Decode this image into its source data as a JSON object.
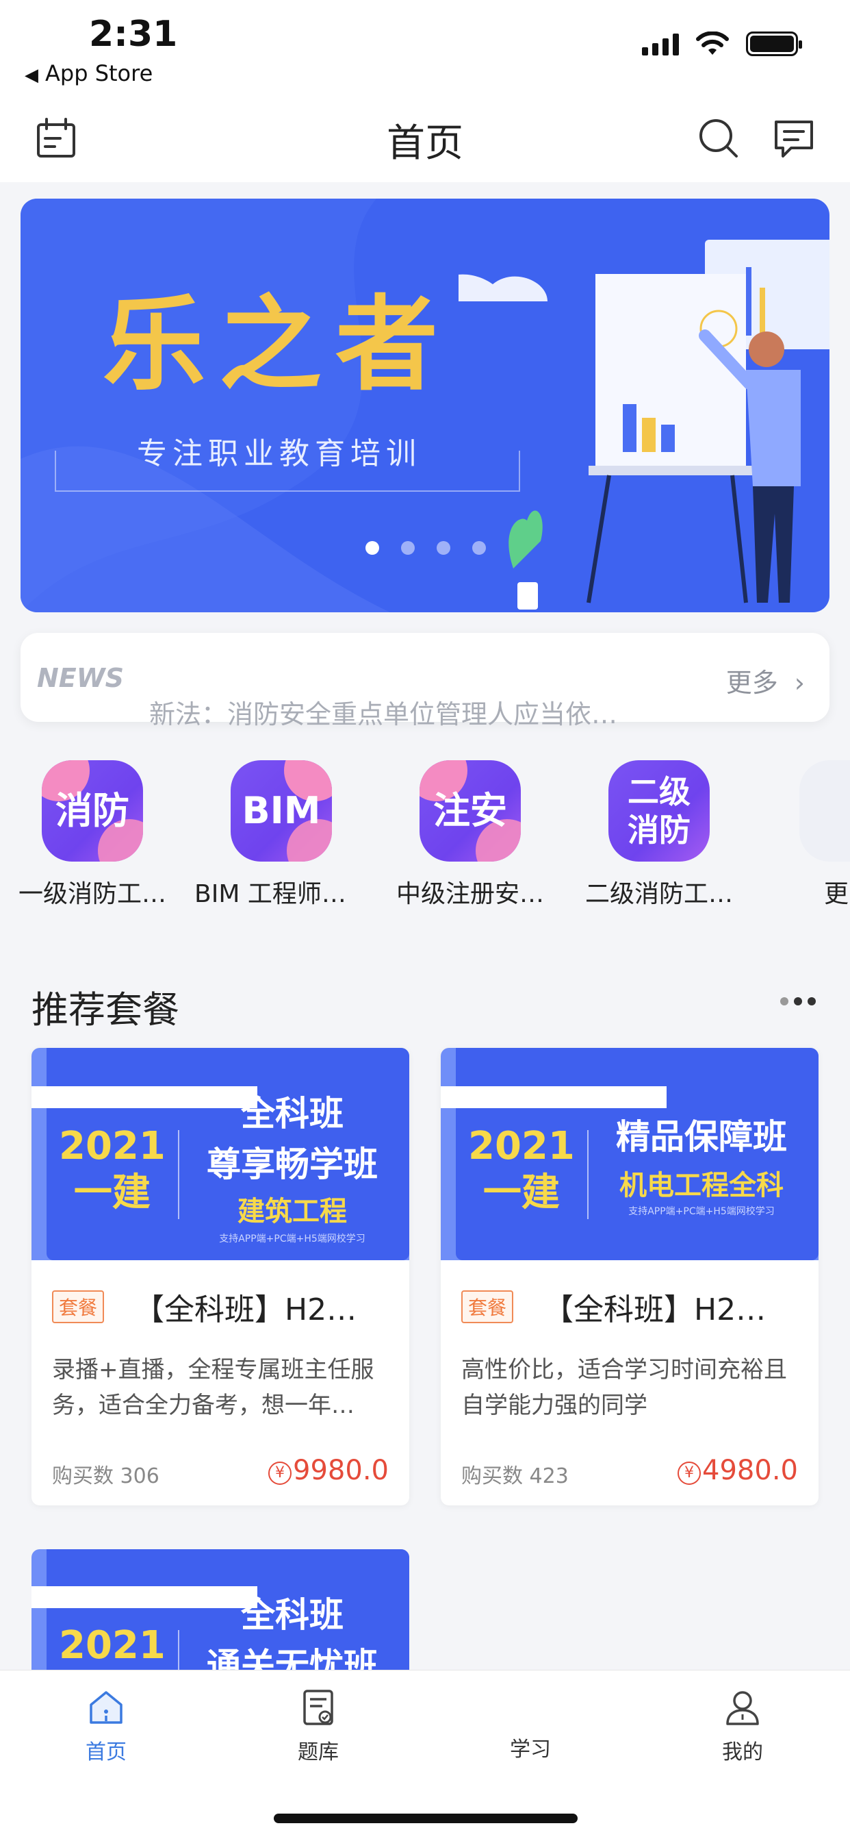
{
  "status_bar": {
    "time": "2:31",
    "back_app": "App Store"
  },
  "nav": {
    "title": "首页"
  },
  "banner": {
    "title": "乐之者",
    "subtitle": "专注职业教育培训",
    "dots": 4,
    "active_dot": 1
  },
  "news": {
    "tag": "NEWS",
    "text": "新法：消防安全重点单位管理人应当依…",
    "more": "更多"
  },
  "categories": [
    {
      "icon_text": "消防",
      "label": "一级消防工…"
    },
    {
      "icon_text": "BIM",
      "label": "BIM 工程师＋…"
    },
    {
      "icon_text": "注安",
      "label": "中级注册安…"
    },
    {
      "icon_text": "二级 消防",
      "label": "二级消防工…"
    },
    {
      "icon_text": "",
      "label": "更"
    }
  ],
  "section": {
    "title": "推荐套餐"
  },
  "cards": [
    {
      "img": {
        "year": "2021",
        "year_line2": "一建",
        "line1": "全科班",
        "line2": "尊享畅学班",
        "line3": "建筑工程",
        "note": "支持APP端+PC端+H5端网校学习"
      },
      "tag": "套餐",
      "title": "【全科班】H2…",
      "desc": "录播+直播，全程专属班主任服务，适合全力备考，想一年…",
      "buy_label": "购买数 306",
      "price": "9980.0"
    },
    {
      "img": {
        "year": "2021",
        "year_line2": "一建",
        "line1": "精品保障班",
        "line2": "机电工程全科",
        "line3": "",
        "note": "支持APP端+PC端+H5端网校学习"
      },
      "tag": "套餐",
      "title": "【全科班】H2…",
      "desc": "高性价比，适合学习时间充裕且自学能力强的同学",
      "buy_label": "购买数 423",
      "price": "4980.0"
    },
    {
      "img": {
        "year": "2021",
        "line1": "全科班",
        "line2": "通关无忧班"
      }
    }
  ],
  "tabbar": [
    {
      "label": "首页",
      "icon": "home-icon",
      "active": true
    },
    {
      "label": "题库",
      "icon": "question-bank-icon",
      "active": false
    },
    {
      "label": "学习",
      "icon": "study-icon",
      "active": false
    },
    {
      "label": "我的",
      "icon": "profile-icon",
      "active": false
    }
  ],
  "colors": {
    "brand_blue": "#3e63f0",
    "accent_gold": "#f4c64a",
    "price_red": "#e54b3a",
    "tab_active": "#3b7ae0"
  }
}
